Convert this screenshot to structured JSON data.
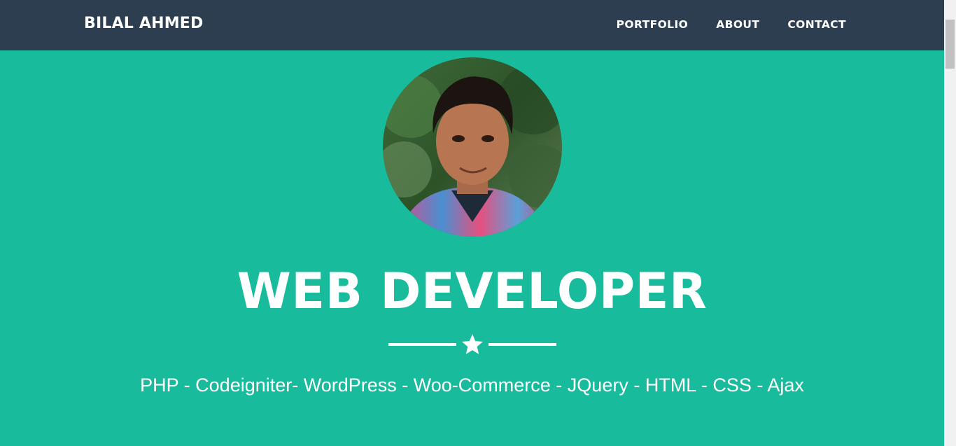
{
  "nav": {
    "brand": "BILAL AHMED",
    "links": [
      {
        "label": "PORTFOLIO"
      },
      {
        "label": "ABOUT"
      },
      {
        "label": "CONTACT"
      }
    ]
  },
  "hero": {
    "title": "WEB DEVELOPER",
    "skills": "PHP - Codeigniter- WordPress - Woo-Commerce - JQuery - HTML - CSS - Ajax",
    "divider_icon": "star-icon"
  },
  "colors": {
    "navbar": "#2c3e50",
    "hero_background": "#18bc9c",
    "text": "#ffffff"
  }
}
